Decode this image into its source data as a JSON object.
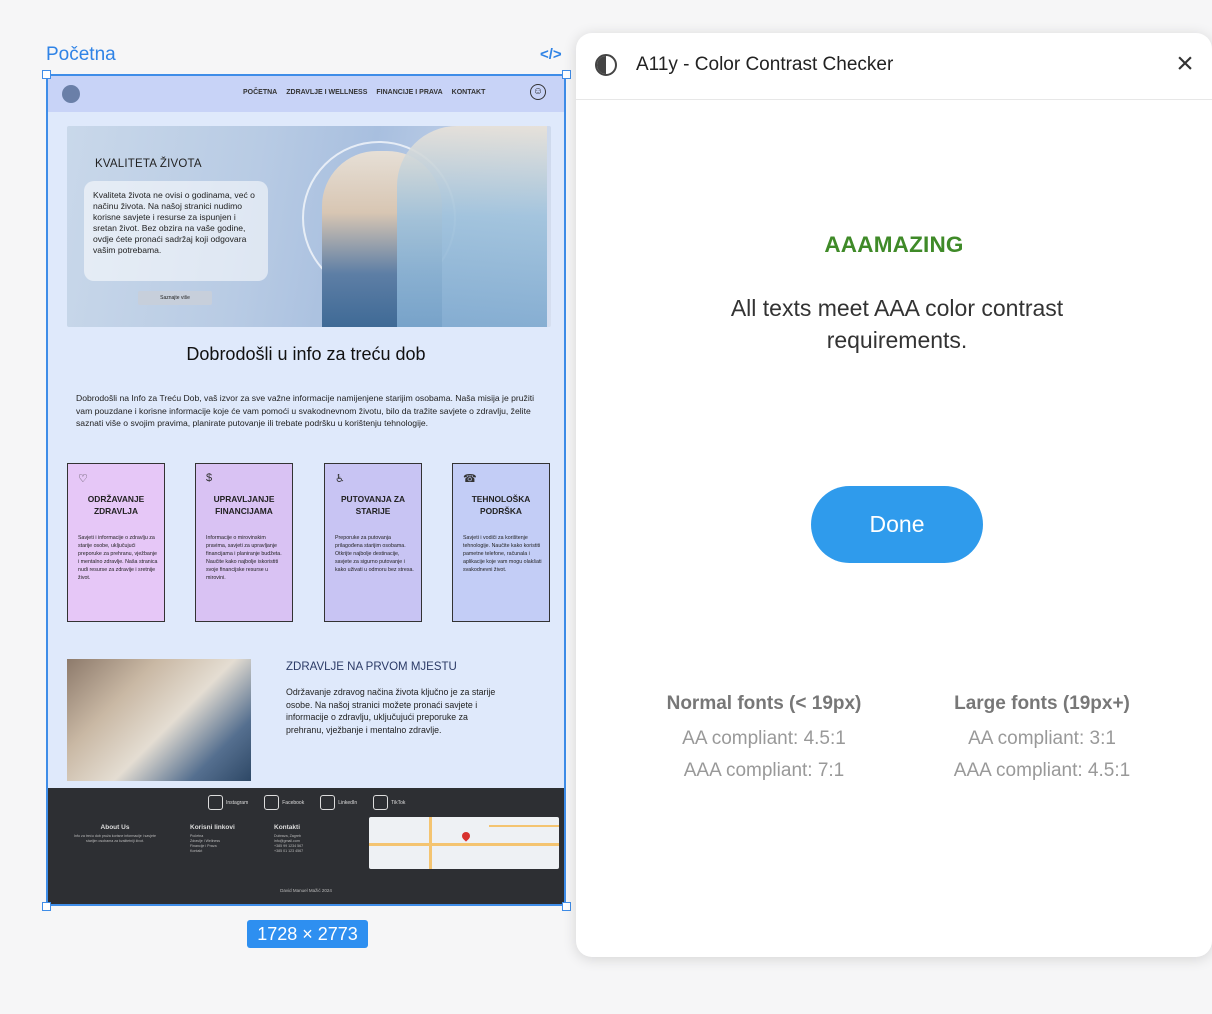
{
  "canvas": {
    "frame_label": "Početna",
    "code_icon": "</>",
    "frame_size": "1728 × 2773"
  },
  "site": {
    "nav": {
      "links": [
        "POČETNA",
        "ZDRAVLJE I WELLNESS",
        "FINANCIJE I PRAVA",
        "KONTAKT"
      ],
      "accessibility_icon": "accessibility-icon"
    },
    "hero": {
      "title": "KVALITETA ŽIVOTA",
      "text": "Kvaliteta života ne ovisi o godinama, već o načinu života. Na našoj stranici nudimo korisne savjete i resurse za ispunjen i sretan život. Bez obzira na vaše godine, ovdje ćete pronaći sadržaj koji odgovara vašim potrebama.",
      "button": "Saznajte više"
    },
    "welcome": {
      "title": "Dobrodošli u info za treću dob",
      "text": "Dobrodošli na Info za Treću Dob, vaš izvor za sve važne informacije namijenjene starijim osobama. Naša misija je pružiti vam pouzdane i korisne informacije koje će vam pomoći u svakodnevnom životu, bilo da tražite savjete o zdravlju, želite saznati više o svojim pravima, planirate putovanje ili trebate podršku u korištenju tehnologije."
    },
    "cards": [
      {
        "title": "ODRŽAVANJE ZDRAVLJA",
        "icon": "heart-icon",
        "color": "#e6c7f7",
        "text": "Savjeti i informacije o zdravlju za starije osobe, uključujući preporuke za prehranu, vježbanje i mentalno zdravlje. Naša stranica nudi resurse za zdravije i sretnije život."
      },
      {
        "title": "UPRAVLJANJE FINANCIJAMA",
        "icon": "money-icon",
        "color": "#d9c2f3",
        "text": "Informacije o mirovinskim pravima, savjeti za upravljanje financijama i planiranje budžeta. Naučite kako najbolje iskoristiti svoje financijske resurse u mirovini."
      },
      {
        "title": "PUTOVANJA ZA STARIJE",
        "icon": "walker-icon",
        "color": "#c8c4f3",
        "text": "Preporuke za putovanja prilagođena starijim osobama. Otkrijte najbolje destinacije, savjete za sigurno putovanje i kako uživati u odmoru bez stresa."
      },
      {
        "title": "TEHNOLOŠKA PODRŠKA",
        "icon": "support-icon",
        "color": "#c3cdf6",
        "text": "Savjeti i vodiči za korištenje tehnologije. Naučite kako koristiti pametne telefone, računala i aplikacije koje vam mogu olakšati svakodnevni život."
      }
    ],
    "health": {
      "title": "ZDRAVLJE NA PRVOM MJESTU",
      "text": "Održavanje zdravog načina života ključno je za starije osobe. Na našoj stranici možete pronaći savjete i informacije o zdravlju, uključujući preporuke za prehranu, vježbanje i mentalno zdravlje."
    },
    "footer": {
      "social": [
        "Instagram",
        "Facebook",
        "LinkedIn",
        "TikTok"
      ],
      "about_title": "About Us",
      "about_text": "Info za treću dob pruža korisne informacije i savjete starijim osobama za kvalitetniji život.",
      "links_title": "Korisni linkovi",
      "links": [
        "Početna",
        "Zdravlje i Wellness",
        "Financije i Prava",
        "Kontakt"
      ],
      "contact_title": "Kontakti",
      "contacts": [
        "Dubrava, Zagreb",
        "info@gmail.com",
        "+385 99 1234 567",
        "+385 01 123 4567"
      ],
      "copyright": "David Manuel Mažić 2024"
    }
  },
  "panel": {
    "icon": "contrast-icon",
    "title": "A11y - Color Contrast Checker",
    "close_icon": "close-icon",
    "result_title": "AAAMAZING",
    "result_text": "All texts meet AAA color contrast requirements.",
    "done_label": "Done",
    "normal": {
      "heading": "Normal fonts (< 19px)",
      "aa": "AA compliant: 4.5:1",
      "aaa": "AAA compliant: 7:1"
    },
    "large": {
      "heading": "Large fonts (19px+)",
      "aa": "AA compliant: 3:1",
      "aaa": "AAA compliant: 4.5:1"
    },
    "colors": {
      "success": "#3f8a28",
      "primary": "#2f9bec"
    }
  }
}
